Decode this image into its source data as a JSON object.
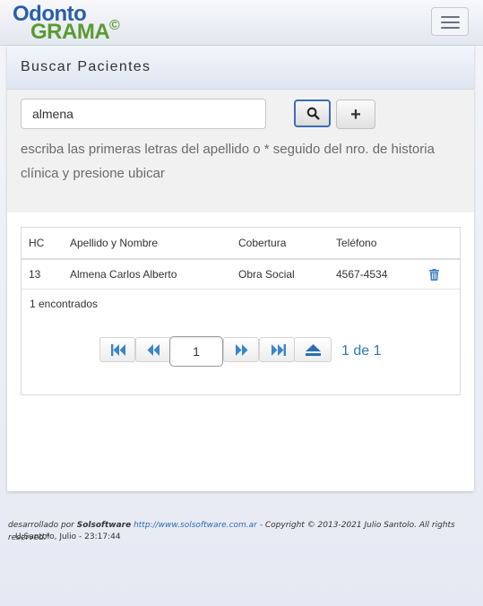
{
  "header": {
    "logo_line1": "Odonto",
    "logo_line2": "GRAMA",
    "logo_mark": "©",
    "menu_icon": "hamburger-icon"
  },
  "panel": {
    "title": "Buscar Pacientes"
  },
  "search": {
    "value": "almena",
    "search_icon": "search-icon",
    "add_label": "+",
    "hint": "escriba las primeras letras del apellido o * seguido del nro. de historia clínica y presione ubicar"
  },
  "table": {
    "headers": [
      "HC",
      "Apellido y Nombre",
      "Cobertura",
      "Teléfono"
    ],
    "rows": [
      {
        "hc": "13",
        "name": "Almena Carlos Alberto",
        "coverage": "Obra Social",
        "phone": "4567-4534",
        "action_icon": "trash-icon"
      }
    ],
    "count_text": "1 encontrados"
  },
  "pager": {
    "current_page": "1",
    "total_text": "1 de 1",
    "icons": [
      "first-page-icon",
      "previous-page-icon",
      "next-page-icon",
      "last-page-icon",
      "eject-icon"
    ]
  },
  "footer": {
    "prefix": "desarrollado por ",
    "company": "Solsoftware",
    "url": "http://www.solsoftware.com.ar",
    "copyright": " - Copyright © 2013-2021 Julio Santolo. All rights reserved.\"",
    "user_line": "U:Santolo, Julio - 23:17:44"
  },
  "colors": {
    "accent_blue": "#3a6fb5",
    "pager_text": "#2a7ab8",
    "logo_blue": "#2a5fa6",
    "logo_green": "#5a9a32"
  }
}
